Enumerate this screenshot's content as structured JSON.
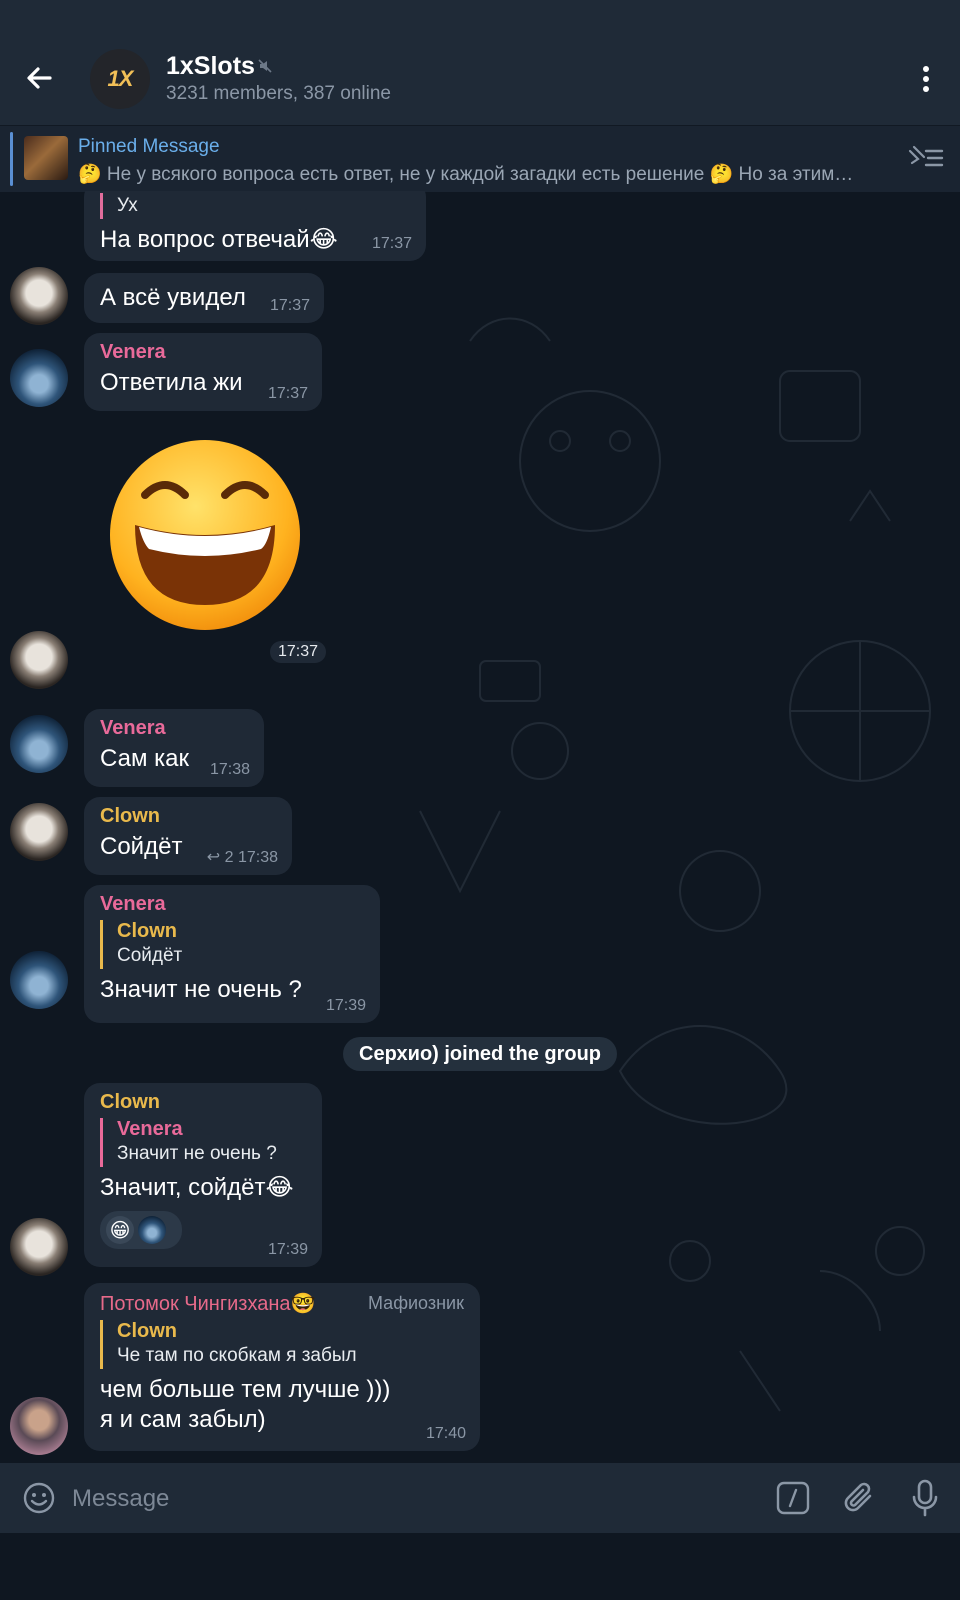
{
  "header": {
    "avatar_text": "1X",
    "title": "1xSlots",
    "subtitle": "3231 members, 387 online"
  },
  "pinned": {
    "title": "Pinned Message",
    "text": "🤔 Не у всякого вопроса есть ответ, не у каждой загадки есть решение 🤔  Но за этим…"
  },
  "messages": {
    "m1": {
      "reply_text": "Ух",
      "text": "На вопрос отвечай😂",
      "time": "17:37"
    },
    "m2": {
      "text": "А всё увидел",
      "time": "17:37"
    },
    "m3": {
      "sender": "Venera",
      "text": "Ответила жи",
      "time": "17:37"
    },
    "m4": {
      "time": "17:37"
    },
    "m5": {
      "sender": "Venera",
      "text": "Сам как",
      "time": "17:38"
    },
    "m6": {
      "sender": "Clown",
      "text": "Сойдёт",
      "reply_count": "↩ 2",
      "time": "17:38"
    },
    "m7": {
      "sender": "Venera",
      "reply_name": "Clown",
      "reply_text": "Сойдёт",
      "text": "Значит не очень ?",
      "time": "17:39"
    },
    "system": "Серхио) joined the group",
    "m8": {
      "sender": "Clown",
      "reply_name": "Venera",
      "reply_text": "Значит не очень ?",
      "text": "Значит, сойдёт😂",
      "time": "17:39"
    },
    "m9": {
      "sender": "Потомок Чингизхана🤓",
      "role": "Мафиозник",
      "reply_name": "Clown",
      "reply_text": "Че там по скобкам я забыл",
      "text_line1": "чем больше тем лучше  )))",
      "text_line2": "я и сам забыл)",
      "time": "17:40"
    }
  },
  "input": {
    "placeholder": "Message"
  },
  "colors": {
    "header_bg": "#1f2a37",
    "chat_bg": "#0f1721",
    "bubble_bg": "#1f2936",
    "venera": "#e96a9a",
    "clown": "#e9b94c",
    "potomok": "#e76a8a",
    "link": "#6aaeea"
  }
}
